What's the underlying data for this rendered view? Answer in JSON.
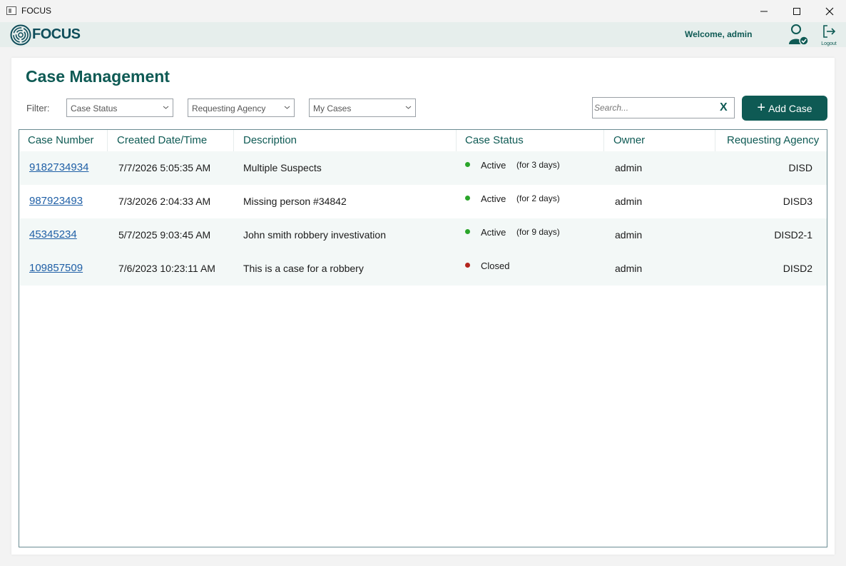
{
  "window": {
    "title": "FOCUS"
  },
  "header": {
    "logo_text": "FOCUS",
    "welcome": "Welcome, admin",
    "logout_label": "Logout"
  },
  "page": {
    "title": "Case Management"
  },
  "filters": {
    "label": "Filter:",
    "case_status": "Case Status",
    "requesting_agency": "Requesting Agency",
    "my_cases": "My Cases"
  },
  "search": {
    "placeholder": "Search...",
    "clear_label": "X"
  },
  "add_case": {
    "label": "Add Case"
  },
  "table": {
    "columns": [
      "Case Number",
      "Created Date/Time",
      "Description",
      "Case Status",
      "Owner",
      "Requesting Agency"
    ],
    "rows": [
      {
        "case_number": "9182734934",
        "created": "7/7/2026 5:05:35 AM",
        "description": "Multiple Suspects",
        "status": "Active",
        "status_color": "#2aa52a",
        "duration": "(for 3 days)",
        "owner": "admin",
        "agency": "DISD"
      },
      {
        "case_number": "987923493",
        "created": "7/3/2026 2:04:33 AM",
        "description": "Missing person #34842",
        "status": "Active",
        "status_color": "#2aa52a",
        "duration": "(for 2 days)",
        "owner": "admin",
        "agency": "DISD3"
      },
      {
        "case_number": "45345234",
        "created": "5/7/2025 9:03:45 AM",
        "description": "John smith robbery investivation",
        "status": "Active",
        "status_color": "#2aa52a",
        "duration": "(for 9 days)",
        "owner": "admin",
        "agency": "DISD2-1"
      },
      {
        "case_number": "109857509",
        "created": "7/6/2023 10:23:11 AM",
        "description": "This is a case for a robbery",
        "status": "Closed",
        "status_color": "#b3261e",
        "duration": "",
        "owner": "admin",
        "agency": "DISD2"
      }
    ]
  },
  "colors": {
    "accent": "#0e5a54",
    "link": "#1f5fa6",
    "header_bg": "#e6eeec",
    "row_alt": "#f3f8f7"
  }
}
